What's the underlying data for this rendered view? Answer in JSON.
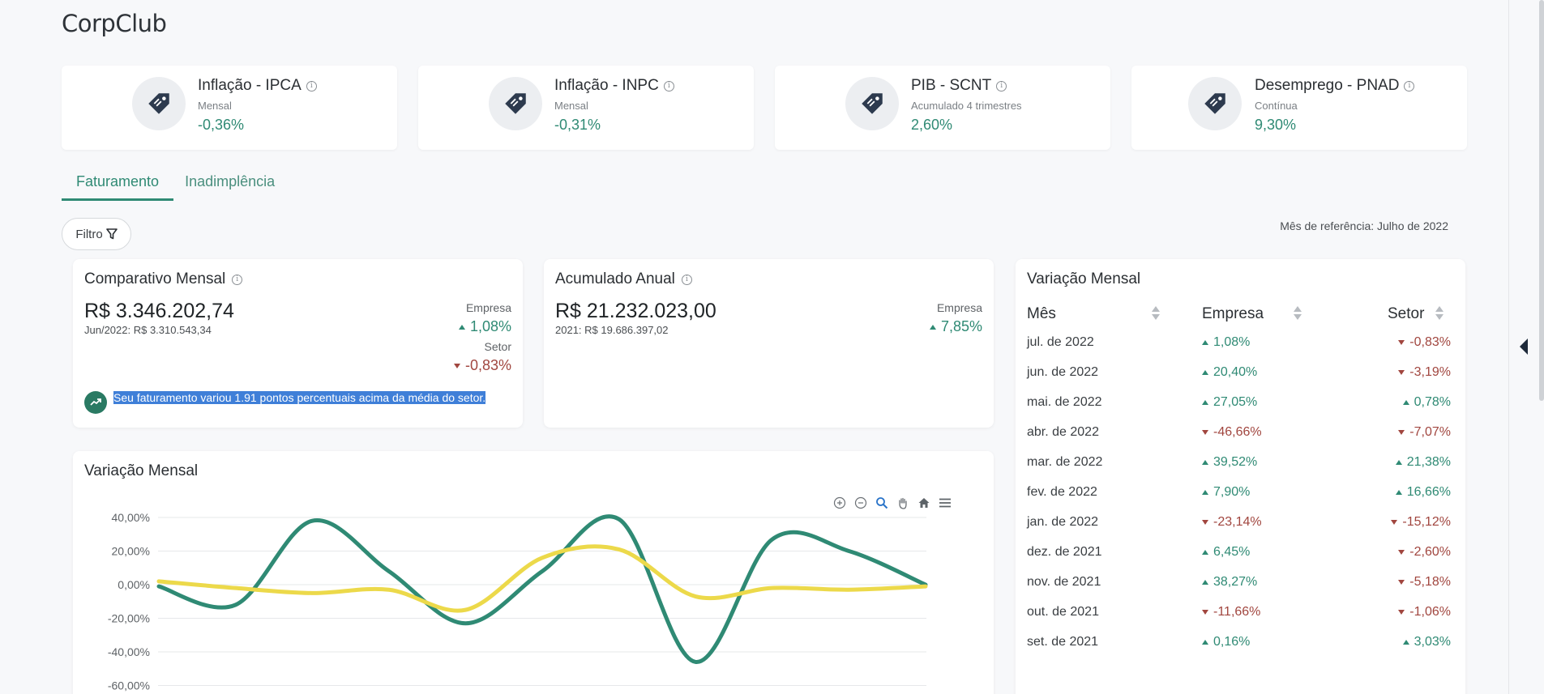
{
  "app": {
    "title": "CorpClub"
  },
  "kpis": [
    {
      "title": "Inflação - IPCA",
      "sub": "Mensal",
      "value": "-0,36%"
    },
    {
      "title": "Inflação - INPC",
      "sub": "Mensal",
      "value": "-0,31%"
    },
    {
      "title": "PIB - SCNT",
      "sub": "Acumulado 4 trimestres",
      "value": "2,60%"
    },
    {
      "title": "Desemprego - PNAD",
      "sub": "Contínua",
      "value": "9,30%"
    }
  ],
  "tabs": [
    {
      "label": "Faturamento",
      "active": true
    },
    {
      "label": "Inadimplência",
      "active": false
    }
  ],
  "filter": {
    "label": "Filtro"
  },
  "reference_month": "Mês de referência: Julho de 2022",
  "monthly_comparison": {
    "title": "Comparativo Mensal",
    "value": "R$ 3.346.202,74",
    "previous": "Jun/2022: R$ 3.310.543,34",
    "company_label": "Empresa",
    "company_value": "1,08%",
    "sector_label": "Setor",
    "sector_value": "-0,83%",
    "message": "Seu faturamento variou 1.91 pontos percentuais acima da média do setor."
  },
  "annual_accumulated": {
    "title": "Acumulado Anual",
    "value": "R$ 21.232.023,00",
    "previous": "2021: R$ 19.686.397,02",
    "company_label": "Empresa",
    "company_value": "7,85%"
  },
  "variation_table": {
    "title": "Variação Mensal",
    "headers": {
      "month": "Mês",
      "company": "Empresa",
      "sector": "Setor"
    },
    "rows": [
      {
        "month": "jul. de 2022",
        "company": "1,08%",
        "company_dir": "up",
        "sector": "-0,83%",
        "sector_dir": "down"
      },
      {
        "month": "jun. de 2022",
        "company": "20,40%",
        "company_dir": "up",
        "sector": "-3,19%",
        "sector_dir": "down"
      },
      {
        "month": "mai. de 2022",
        "company": "27,05%",
        "company_dir": "up",
        "sector": "0,78%",
        "sector_dir": "up"
      },
      {
        "month": "abr. de 2022",
        "company": "-46,66%",
        "company_dir": "down",
        "sector": "-7,07%",
        "sector_dir": "down"
      },
      {
        "month": "mar. de 2022",
        "company": "39,52%",
        "company_dir": "up",
        "sector": "21,38%",
        "sector_dir": "up"
      },
      {
        "month": "fev. de 2022",
        "company": "7,90%",
        "company_dir": "up",
        "sector": "16,66%",
        "sector_dir": "up"
      },
      {
        "month": "jan. de 2022",
        "company": "-23,14%",
        "company_dir": "down",
        "sector": "-15,12%",
        "sector_dir": "down"
      },
      {
        "month": "dez. de 2021",
        "company": "6,45%",
        "company_dir": "up",
        "sector": "-2,60%",
        "sector_dir": "down"
      },
      {
        "month": "nov. de 2021",
        "company": "38,27%",
        "company_dir": "up",
        "sector": "-5,18%",
        "sector_dir": "down"
      },
      {
        "month": "out. de 2021",
        "company": "-11,66%",
        "company_dir": "down",
        "sector": "-1,06%",
        "sector_dir": "down"
      },
      {
        "month": "set. de 2021",
        "company": "0,16%",
        "company_dir": "up",
        "sector": "3,03%",
        "sector_dir": "up"
      }
    ]
  },
  "chart_card": {
    "title": "Variação Mensal"
  },
  "chart_data": {
    "type": "line",
    "title": "Variação Mensal",
    "y_ticks": [
      "40,00%",
      "20,00%",
      "0,00%",
      "-20,00%",
      "-40,00%",
      "-60,00%"
    ],
    "ylim": [
      -60,
      40
    ],
    "grid": true,
    "series": [
      {
        "color": "#2f8a74",
        "values": [
          -1,
          -12,
          38,
          8,
          -23,
          8,
          39,
          -46,
          27,
          20,
          0
        ]
      },
      {
        "color": "#ecd94a",
        "values": [
          2,
          -2,
          -5,
          -3,
          -15,
          16,
          21,
          -7,
          -2,
          -3,
          -1
        ]
      }
    ]
  },
  "colors": {
    "accent": "#2f8a74",
    "negative": "#a1463f",
    "sector_line": "#ecd94a"
  }
}
